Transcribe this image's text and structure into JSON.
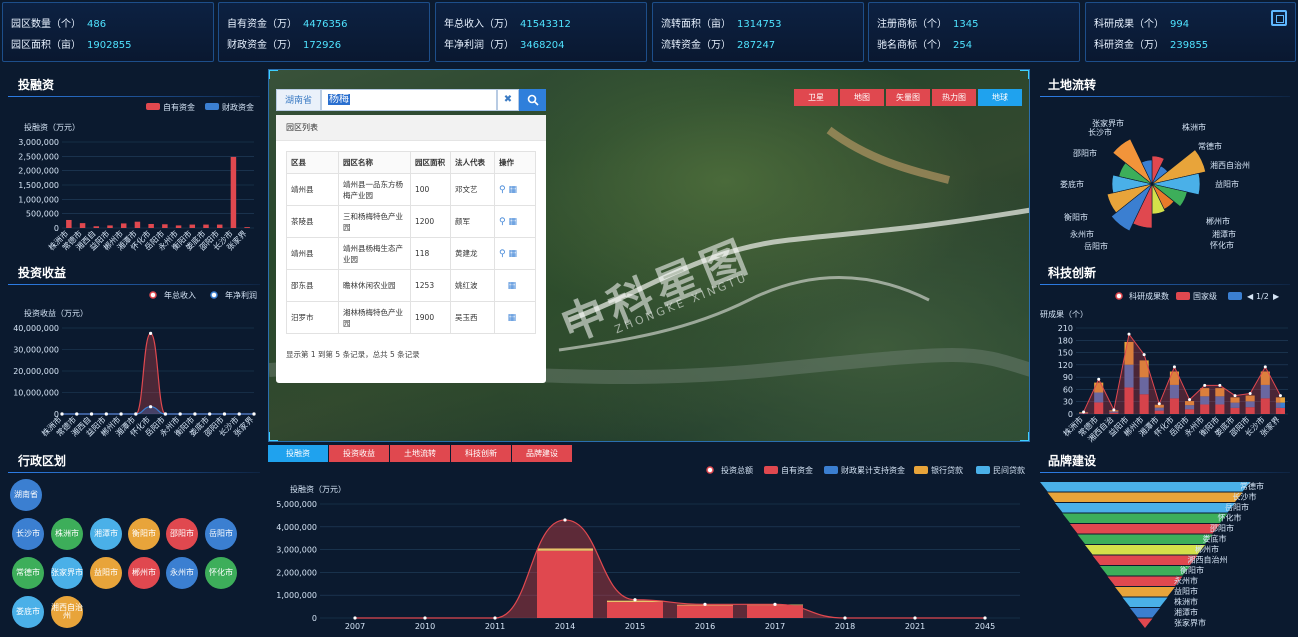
{
  "stats": [
    {
      "r1_label": "园区数量（个）",
      "r1_value": "486",
      "r2_label": "园区面积（亩）",
      "r2_value": "1902855"
    },
    {
      "r1_label": "自有资金（万）",
      "r1_value": "4476356",
      "r2_label": "财政资金（万）",
      "r2_value": "172926"
    },
    {
      "r1_label": "年总收入（万）",
      "r1_value": "41543312",
      "r2_label": "年净利润（万）",
      "r2_value": "3468204"
    },
    {
      "r1_label": "流转面积（亩）",
      "r1_value": "1314753",
      "r2_label": "流转资金（万）",
      "r2_value": "287247"
    },
    {
      "r1_label": "注册商标（个）",
      "r1_value": "1345",
      "r2_label": "驰名商标（个）",
      "r2_value": "254"
    },
    {
      "r1_label": "科研成果（个）",
      "r1_value": "994",
      "r2_label": "科研资金（万）",
      "r2_value": "239855"
    }
  ],
  "panels": {
    "investment_title": "投融资",
    "return_title": "投资收益",
    "district_title": "行政区划",
    "land_title": "土地流转",
    "tech_title": "科技创新",
    "brand_title": "品牌建设"
  },
  "search": {
    "province": "湖南省",
    "query": "杨梅"
  },
  "park_list": {
    "title": "园区列表",
    "headers": [
      "区县",
      "园区名称",
      "园区面积",
      "法人代表",
      "操作"
    ],
    "rows": [
      [
        "靖州县",
        "靖州县一品东方杨梅产业园",
        "100",
        "邓文艺"
      ],
      [
        "茶陵县",
        "三和杨梅特色产业园",
        "1200",
        "颜军"
      ],
      [
        "靖州县",
        "靖州县杨梅生态产业园",
        "118",
        "黄建龙"
      ],
      [
        "邵东县",
        "瞻林休闲农业园",
        "1253",
        "姚红波"
      ],
      [
        "汨罗市",
        "湘林杨梅特色产业园",
        "1900",
        "吴玉西"
      ]
    ],
    "footer": "显示第 1 到第 5 条记录，总共 5 条记录"
  },
  "map_tabs": [
    "卫星",
    "地图",
    "矢量图",
    "热力图",
    "地球"
  ],
  "map_tab_active": 4,
  "bottom_tabs": [
    "投融资",
    "投资收益",
    "土地流转",
    "科技创新",
    "品牌建设"
  ],
  "bottom_tab_active": 0,
  "watermark": {
    "cn": "中科星图",
    "en": "ZHONGKE XINGTU"
  },
  "districts": {
    "province": "湖南省",
    "cities": [
      "长沙市",
      "株洲市",
      "湘潭市",
      "衡阳市",
      "邵阳市",
      "岳阳市",
      "常德市",
      "张家界市",
      "益阳市",
      "郴州市",
      "永州市",
      "怀化市",
      "娄底市",
      "湘西自治州"
    ]
  },
  "chart_data": [
    {
      "type": "bar",
      "title": "投融资",
      "ylabel": "投融资（万元）",
      "legend": [
        "自有资金",
        "财政资金"
      ],
      "categories": [
        "株洲市",
        "常德市",
        "湘西自",
        "益阳市",
        "郴州市",
        "湘潭市",
        "怀化市",
        "岳阳市",
        "永州市",
        "衡阳市",
        "娄底市",
        "邵阳市",
        "长沙市",
        "张家界"
      ],
      "series": [
        {
          "name": "自有资金",
          "values": [
            280000,
            170000,
            60000,
            90000,
            160000,
            220000,
            140000,
            130000,
            90000,
            120000,
            120000,
            120000,
            2480000,
            30000
          ]
        },
        {
          "name": "财政资金",
          "values": [
            10000,
            8000,
            3000,
            5000,
            8000,
            10000,
            7000,
            6000,
            5000,
            6000,
            6000,
            6000,
            40000,
            2000
          ]
        }
      ],
      "ylim": [
        0,
        3000000
      ],
      "yticks": [
        "0",
        "500,000",
        "1,000,000",
        "1,500,000",
        "2,000,000",
        "2,500,000",
        "3,000,000"
      ]
    },
    {
      "type": "line",
      "title": "投资收益",
      "ylabel": "投资收益（万元）",
      "legend": [
        "年总收入",
        "年净利润"
      ],
      "categories": [
        "株洲市",
        "常德市",
        "湘西自",
        "益阳市",
        "郴州市",
        "湘潭市",
        "怀化市",
        "岳阳市",
        "永州市",
        "衡阳市",
        "娄底市",
        "邵阳市",
        "长沙市",
        "张家界"
      ],
      "series": [
        {
          "name": "年总收入",
          "values": [
            0,
            0,
            0,
            0,
            0,
            0,
            37500000,
            0,
            0,
            0,
            0,
            0,
            0,
            0
          ]
        },
        {
          "name": "年净利润",
          "values": [
            0,
            0,
            0,
            0,
            0,
            0,
            3400000,
            0,
            0,
            0,
            0,
            0,
            0,
            0
          ]
        }
      ],
      "ylim": [
        0,
        40000000
      ],
      "yticks": [
        "0",
        "10,000,000",
        "20,000,000",
        "30,000,000",
        "40,000,000"
      ]
    },
    {
      "type": "pie",
      "title": "土地流转",
      "labels": [
        "张家界市",
        "长沙市",
        "株洲市",
        "邵阳市",
        "常德市",
        "湘西自治州",
        "益阳市",
        "娄底市",
        "衡阳市",
        "郴州市",
        "永州市",
        "湘潭市",
        "岳阳市",
        "怀化市"
      ]
    },
    {
      "type": "bar",
      "title": "科技创新",
      "ylabel": "研成果（个）",
      "legend": [
        "科研成果数",
        "国家级"
      ],
      "pager": "1/2",
      "categories": [
        "株洲市",
        "常德市",
        "湘西自治",
        "益阳市",
        "郴州市",
        "湘潭市",
        "怀化市",
        "岳阳市",
        "永州市",
        "衡阳市",
        "娄底市",
        "邵阳市",
        "长沙市",
        "张家界"
      ],
      "line_values": [
        5,
        85,
        10,
        195,
        145,
        25,
        115,
        35,
        70,
        70,
        45,
        50,
        115,
        45
      ],
      "ylim": [
        0,
        210
      ],
      "yticks": [
        "0",
        "30",
        "60",
        "90",
        "120",
        "150",
        "180",
        "210"
      ]
    },
    {
      "type": "bar",
      "title": "投融资",
      "ylabel": "投融资（万元）",
      "legend": [
        "投资总额",
        "自有资金",
        "财政累计支持资金",
        "银行贷款",
        "民间贷款"
      ],
      "categories": [
        "2007",
        "2010",
        "2011",
        "2014",
        "2015",
        "2016",
        "2017",
        "2018",
        "2021",
        "2045"
      ],
      "series": [
        {
          "name": "投资总额",
          "values": [
            0,
            0,
            0,
            4300000,
            800000,
            600000,
            600000,
            0,
            0,
            0
          ]
        },
        {
          "name": "自有资金",
          "values": [
            0,
            0,
            0,
            2950000,
            700000,
            550000,
            560000,
            0,
            0,
            0
          ]
        },
        {
          "name": "银行贷款",
          "values": [
            0,
            0,
            0,
            100000,
            60000,
            30000,
            30000,
            0,
            0,
            0
          ]
        }
      ],
      "ylim": [
        0,
        5000000
      ],
      "yticks": [
        "0",
        "1,000,000",
        "2,000,000",
        "3,000,000",
        "4,000,000",
        "5,000,000"
      ]
    },
    {
      "type": "funnel",
      "title": "品牌建设",
      "labels": [
        "常德市",
        "长沙市",
        "岳阳市",
        "怀化市",
        "邵阳市",
        "娄底市",
        "郴州市",
        "湘西自治州",
        "衡阳市",
        "永州市",
        "益阳市",
        "株洲市",
        "湘潭市",
        "张家界市"
      ]
    }
  ]
}
